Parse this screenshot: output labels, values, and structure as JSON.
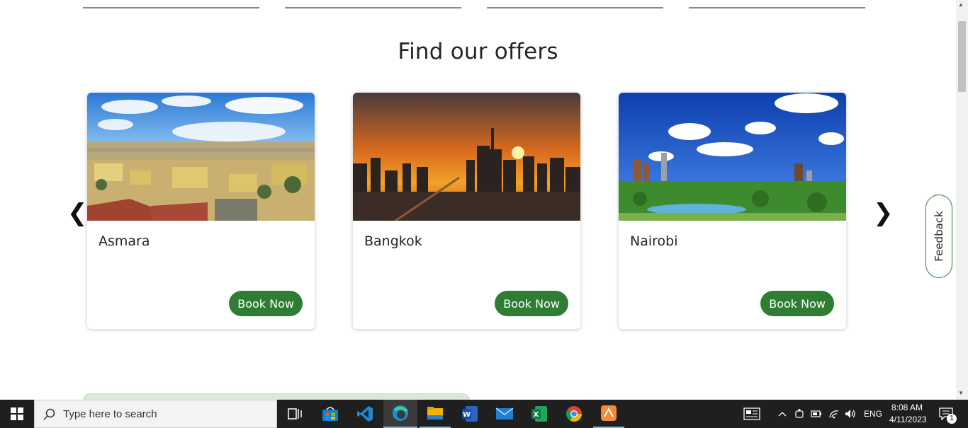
{
  "section": {
    "title": "Find our offers"
  },
  "carousel": {
    "prev_symbol": "❮",
    "next_symbol": "❯",
    "cards": [
      {
        "city": "Asmara",
        "button": "Book Now"
      },
      {
        "city": "Bangkok",
        "button": "Book Now"
      },
      {
        "city": "Nairobi",
        "button": "Book Now"
      }
    ]
  },
  "feedback": {
    "label": "Feedback"
  },
  "colors": {
    "accent": "#2e7d32",
    "text": "#212529"
  },
  "taskbar": {
    "search_placeholder": "Type here to search",
    "language": "ENG",
    "time": "8:08 AM",
    "date": "4/11/2023",
    "notification_count": "1",
    "apps": [
      "task-view",
      "microsoft-store",
      "vs-code",
      "edge",
      "file-explorer",
      "word",
      "mail",
      "excel",
      "chrome",
      "app"
    ]
  }
}
